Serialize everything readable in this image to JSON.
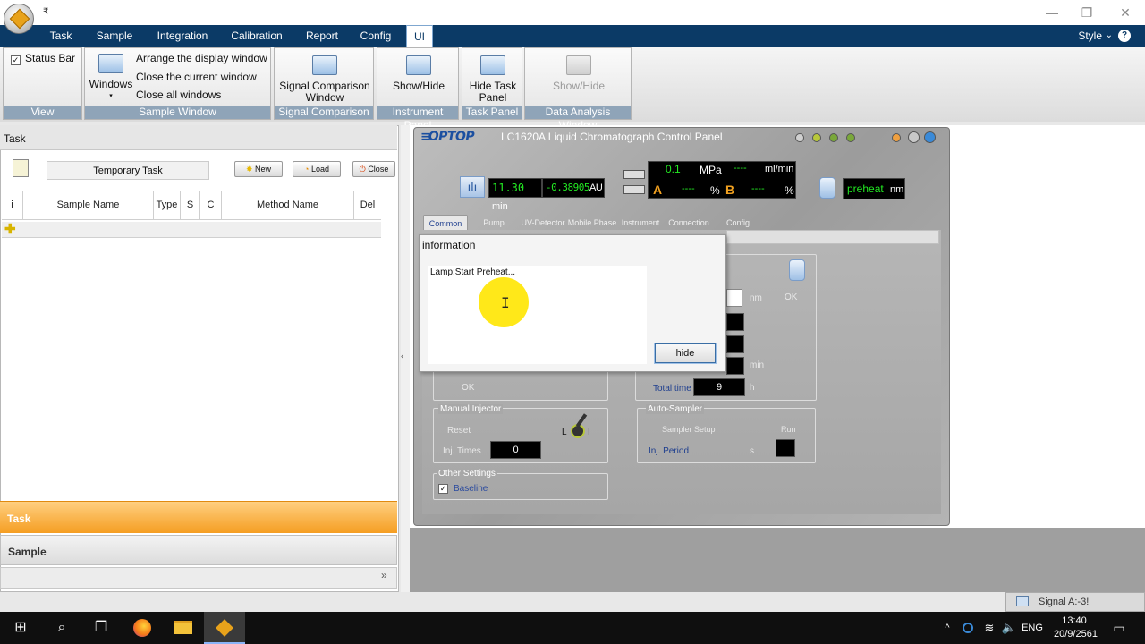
{
  "window": {
    "quick_access": "₹",
    "minimize": "—",
    "restore": "❐",
    "close": "✕"
  },
  "menu": {
    "items": [
      "Task",
      "Sample",
      "Integration",
      "Calibration",
      "Report",
      "Config",
      "UI"
    ],
    "active": "UI",
    "style_label": "Style",
    "style_arrow": "⌄",
    "help": "?"
  },
  "ribbon": {
    "view": {
      "status_bar_label": "Status Bar",
      "status_bar_checked": true,
      "caption": "View"
    },
    "sample_window": {
      "windows_label": "Windows",
      "arrange": "Arrange the display window",
      "close_current": "Close the current window",
      "close_all": "Close all windows",
      "caption": "Sample Window"
    },
    "signal_comparison": {
      "button": "Signal Comparison Window",
      "caption": "Signal Comparison"
    },
    "instrument_panel": {
      "button": "Show/Hide",
      "caption": "Instrument Panel"
    },
    "task_panel": {
      "button": "Hide Task Panel",
      "caption": "Task Panel"
    },
    "data_analysis": {
      "button": "Show/Hide",
      "caption": "Data Analysis Window"
    }
  },
  "task_panel": {
    "header": "Task",
    "temporary_task": "Temporary Task",
    "buttons": {
      "new": "New",
      "load": "Load",
      "close": "Close"
    },
    "columns": [
      "i",
      "Sample Name",
      "Type",
      "S",
      "C",
      "Method Name",
      "Del"
    ],
    "nav": {
      "task": "Task",
      "sample": "Sample",
      "expand": "»"
    },
    "grip": "·········"
  },
  "lc_panel": {
    "logo": "OPTOP",
    "title": "LC1620A Liquid Chromatograph Control Panel",
    "time_value": "11.30",
    "time_unit": "min",
    "au_value": "-0.38905",
    "au_unit": "AU",
    "pressure": "0.1",
    "pressure_unit": "MPa",
    "flow": "----",
    "flow_unit": "ml/min",
    "a_label": "A",
    "a_value": "----",
    "a_unit": "%",
    "b_label": "B",
    "b_value": "----",
    "b_unit": "%",
    "lamp_state": "preheat",
    "lamp_unit": "nm",
    "tabs": [
      "Common",
      "Pump",
      "UV-Detector",
      "Mobile Phase",
      "Instrument",
      "Connection",
      "Config"
    ],
    "active_tab": "Common",
    "detector": {
      "nm_unit": "nm",
      "ok_right": "OK",
      "min_unit": "min",
      "total_time_label": "Total time",
      "total_time_value": "9",
      "total_time_unit": "h"
    },
    "pump_ok": "OK",
    "manual_injector": {
      "title": "Manual Injector",
      "reset": "Reset",
      "inj_times_label": "Inj. Times",
      "inj_times_value": "0",
      "valve_l": "L",
      "valve_i": "I"
    },
    "auto_sampler": {
      "title": "Auto-Sampler",
      "setup": "Sampler Setup",
      "run": "Run",
      "inj_period_label": "Inj. Period",
      "inj_period_unit": "s"
    },
    "other_settings": {
      "title": "Other Settings",
      "baseline_label": "Baseline",
      "baseline_checked": true
    }
  },
  "dialog": {
    "title": "information",
    "message": "Lamp:Start Preheat...",
    "hide_button": "hide",
    "cursor": "I"
  },
  "signal_tab": "Signal A:-3!",
  "taskbar": {
    "language": "ENG",
    "time": "13:40",
    "date": "20/9/2561",
    "tray_caret": "^"
  }
}
